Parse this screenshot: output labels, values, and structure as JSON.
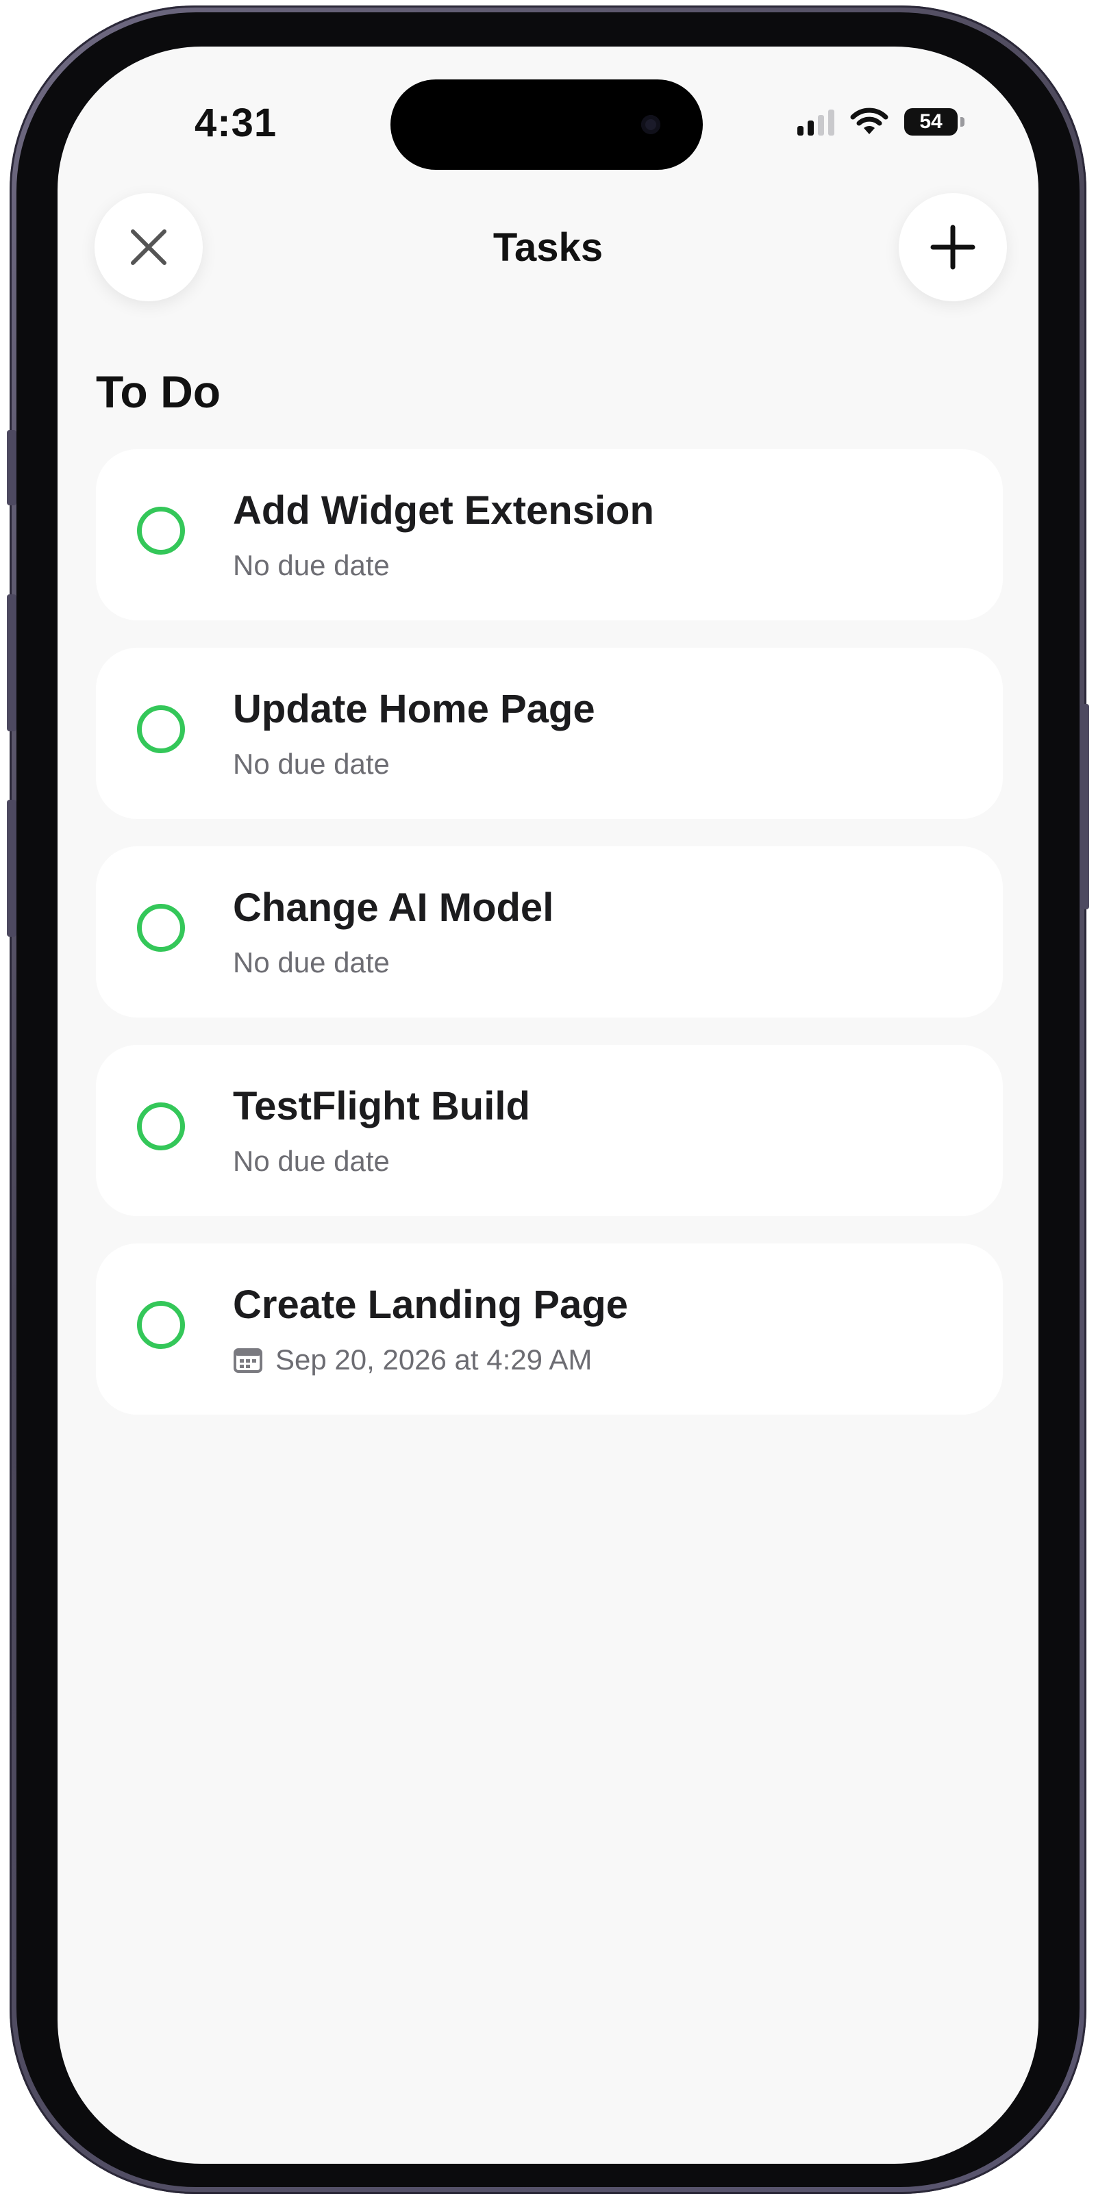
{
  "status_bar": {
    "time": "4:31",
    "battery": "54",
    "icons": [
      "cellular-signal-icon",
      "wifi-icon",
      "battery-icon"
    ]
  },
  "header": {
    "title": "Tasks",
    "close_icon": "close-icon",
    "add_icon": "plus-icon"
  },
  "section": {
    "title": "To Do"
  },
  "colors": {
    "accent_green": "#34c759",
    "background": "#f8f8f8",
    "card": "#ffffff",
    "secondary_text": "#6d6d73"
  },
  "tasks": [
    {
      "title": "Add Widget Extension",
      "subtitle": "No due date",
      "has_date_icon": false
    },
    {
      "title": "Update Home Page",
      "subtitle": "No due date",
      "has_date_icon": false
    },
    {
      "title": "Change AI Model",
      "subtitle": "No due date",
      "has_date_icon": false
    },
    {
      "title": "TestFlight Build",
      "subtitle": "No due date",
      "has_date_icon": false
    },
    {
      "title": "Create Landing Page",
      "subtitle": "Sep 20, 2026 at 4:29 AM",
      "has_date_icon": true
    }
  ]
}
